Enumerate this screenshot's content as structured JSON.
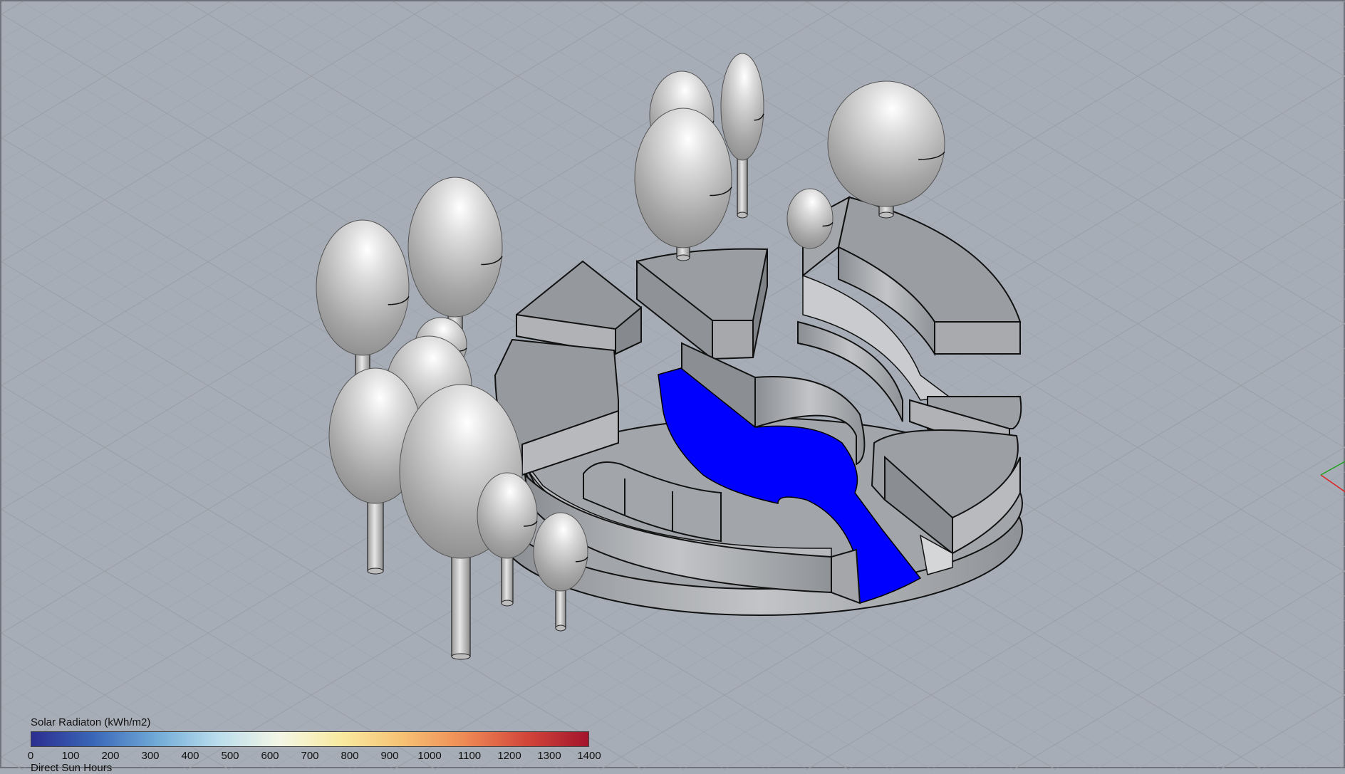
{
  "legend": {
    "title": "Solar Radiaton (kWh/m2)",
    "subtitle": "Direct Sun Hours",
    "ticks": [
      "0",
      "100",
      "200",
      "300",
      "400",
      "500",
      "600",
      "700",
      "800",
      "900",
      "1000",
      "1100",
      "1200",
      "1300",
      "1400"
    ],
    "min": 0,
    "max": 1400,
    "gradient_colors": [
      "#2b2f8f",
      "#3a66b8",
      "#6fa9d6",
      "#b9dcec",
      "#f3f6e6",
      "#f8eaa0",
      "#f6c173",
      "#ee8a55",
      "#d2463a",
      "#a3142c"
    ]
  },
  "scene": {
    "background_color": "#a7adb6",
    "grid_color": "#9aa0a8",
    "surface_color": "#9c9fa4",
    "highlight_surface_color": "#0000ff",
    "objects": [
      "trees",
      "circular-building-massing",
      "courtyard"
    ]
  },
  "axes": {
    "x_color": "#e02020",
    "y_color": "#20a020"
  }
}
